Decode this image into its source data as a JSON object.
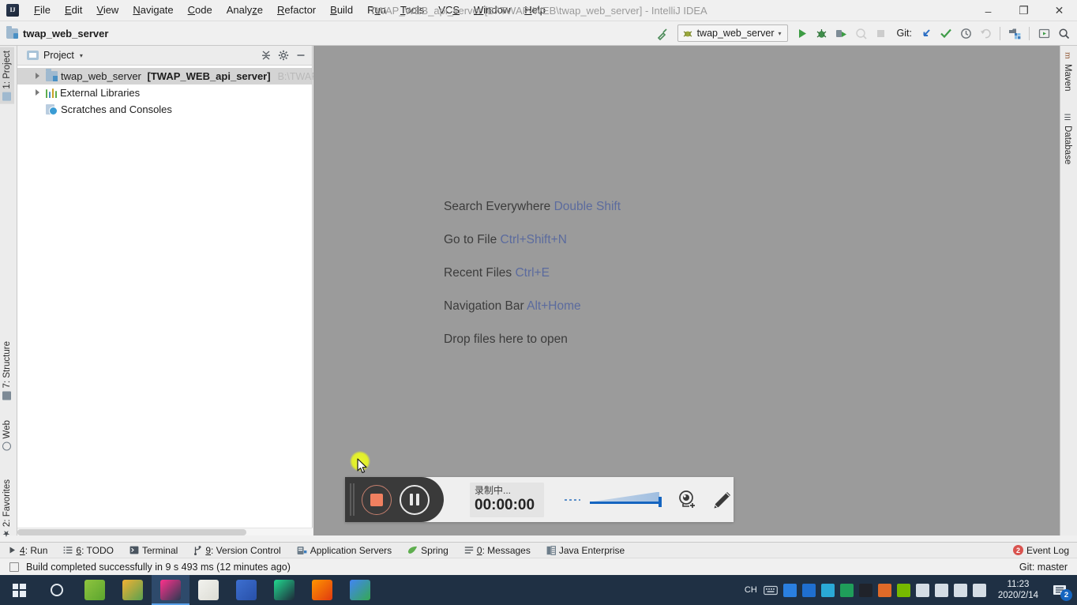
{
  "window": {
    "title": "TWAP_WEB_api_server [B:\\TWAP-WEB\\twap_web_server] - IntelliJ IDEA",
    "minimize": "–",
    "maximize": "❐",
    "close": "✕",
    "logo_text": "IJ"
  },
  "menubar": {
    "items": [
      {
        "label": "File",
        "mnemonic": "F"
      },
      {
        "label": "Edit",
        "mnemonic": "E"
      },
      {
        "label": "View",
        "mnemonic": "V"
      },
      {
        "label": "Navigate",
        "mnemonic": "N"
      },
      {
        "label": "Code",
        "mnemonic": "C"
      },
      {
        "label": "Analyze",
        "mnemonic": "z"
      },
      {
        "label": "Refactor",
        "mnemonic": "R"
      },
      {
        "label": "Build",
        "mnemonic": "B"
      },
      {
        "label": "Run",
        "mnemonic": "u"
      },
      {
        "label": "Tools",
        "mnemonic": "T"
      },
      {
        "label": "VCS",
        "mnemonic": "S"
      },
      {
        "label": "Window",
        "mnemonic": "W"
      },
      {
        "label": "Help",
        "mnemonic": "H"
      }
    ]
  },
  "toolbar": {
    "breadcrumb": "twap_web_server",
    "run_config": "twap_web_server",
    "git_label": "Git:",
    "icons": [
      "build-hammer-icon",
      "run-icon",
      "debug-icon",
      "run-with-coverage-icon",
      "profile-icon",
      "stop-icon",
      "update-project-icon",
      "commit-icon",
      "history-icon",
      "rollback-icon",
      "settings-structure-icon",
      "open-preview-icon",
      "search-everywhere-icon"
    ]
  },
  "stripe_left": {
    "tabs": [
      {
        "label": "1: Project",
        "icon": "project-icon",
        "active": true
      },
      {
        "label": "7: Structure",
        "icon": "structure-icon",
        "active": false
      },
      {
        "label": "Web",
        "icon": "web-icon",
        "active": false
      },
      {
        "label": "2: Favorites",
        "icon": "star-icon",
        "active": false
      }
    ]
  },
  "stripe_right": {
    "tabs": [
      {
        "label": "Maven",
        "icon": "maven-icon"
      },
      {
        "label": "Database",
        "icon": "database-icon"
      }
    ]
  },
  "project_panel": {
    "title": "Project",
    "chevron": "▾",
    "actions": [
      "collapse-all-icon",
      "settings-gear-icon",
      "hide-icon"
    ],
    "tree": [
      {
        "name": "twap_web_server",
        "module": "[TWAP_WEB_api_server]",
        "path": "B:\\TWAP-WEB",
        "icon": "module-icon",
        "expandable": true,
        "selected": true,
        "indent": 0
      },
      {
        "name": "External Libraries",
        "module": "",
        "path": "",
        "icon": "library-icon",
        "expandable": true,
        "selected": false,
        "indent": 0
      },
      {
        "name": "Scratches and Consoles",
        "module": "",
        "path": "",
        "icon": "scratches-icon",
        "expandable": false,
        "selected": false,
        "indent": 0
      }
    ]
  },
  "editor": {
    "hints": [
      {
        "text": "Search Everywhere ",
        "key": "Double Shift"
      },
      {
        "text": "Go to File ",
        "key": "Ctrl+Shift+N"
      },
      {
        "text": "Recent Files ",
        "key": "Ctrl+E"
      },
      {
        "text": "Navigation Bar ",
        "key": "Alt+Home"
      },
      {
        "text": "Drop files here to open",
        "key": ""
      }
    ]
  },
  "recorder": {
    "status": "录制中...",
    "time": "00:00:00",
    "stop_label": "stop-recording-button",
    "pause_label": "pause-recording-button",
    "camera_label": "add-webcam-button",
    "pen_label": "annotation-pen-button",
    "volume_label": "microphone-volume-slider"
  },
  "toolwindow_bar": {
    "items": [
      {
        "label": "4: Run",
        "mnemonic": "4",
        "icon": "run-arrow-icon"
      },
      {
        "label": "6: TODO",
        "mnemonic": "6",
        "icon": "todo-list-icon"
      },
      {
        "label": "Terminal",
        "mnemonic": "",
        "icon": "terminal-icon"
      },
      {
        "label": "9: Version Control",
        "mnemonic": "9",
        "icon": "branch-icon"
      },
      {
        "label": "Application Servers",
        "mnemonic": "",
        "icon": "server-icon"
      },
      {
        "label": "Spring",
        "mnemonic": "",
        "icon": "spring-leaf-icon"
      },
      {
        "label": "0: Messages",
        "mnemonic": "0",
        "icon": "messages-icon"
      },
      {
        "label": "Java Enterprise",
        "mnemonic": "",
        "icon": "java-ee-icon"
      }
    ],
    "event_log": "Event Log",
    "event_log_badge": "2"
  },
  "statusbar": {
    "message": "Build completed successfully in 9 s 493 ms (12 minutes ago)",
    "git_branch": "Git: master"
  },
  "taskbar": {
    "start_label": "start-button",
    "cortana_label": "cortana-search-button",
    "apps": [
      {
        "name": "pycharm-edu-app",
        "color1": "#8fc43f",
        "color2": "#5ba52e"
      },
      {
        "name": "chrome-canary-app",
        "color1": "#f2b134",
        "color2": "#59a14f"
      },
      {
        "name": "intellij-idea-app",
        "color1": "#ff318c",
        "color2": "#2b3a52",
        "active": true
      },
      {
        "name": "typora-app",
        "color1": "#f2f2ee",
        "color2": "#dcdcd4"
      },
      {
        "name": "vysor-app",
        "color1": "#3d6fd0",
        "color2": "#2850a8"
      },
      {
        "name": "webstorm-app",
        "color1": "#22d88f",
        "color2": "#1d2b3a"
      },
      {
        "name": "firefox-app",
        "color1": "#ff9500",
        "color2": "#e03a10"
      },
      {
        "name": "chrome-app",
        "color1": "#4285f4",
        "color2": "#34a853"
      }
    ],
    "ime": "CH",
    "tray": [
      {
        "name": "ime-keyboard-icon",
        "color": "#b8c6d4"
      },
      {
        "name": "baidu-netdisk-icon",
        "color": "#2a7fe0"
      },
      {
        "name": "pdf-reader-icon",
        "color": "#1f6fd0"
      },
      {
        "name": "screen-recorder-icon",
        "color": "#2aa9d6"
      },
      {
        "name": "wps-cloud-icon",
        "color": "#1f9e5a"
      },
      {
        "name": "intellij-tray-icon",
        "color": "#20232a"
      },
      {
        "name": "sync-tool-icon",
        "color": "#e06a28"
      },
      {
        "name": "nvidia-icon",
        "color": "#76b900"
      },
      {
        "name": "network-icon",
        "color": "#d5dde5"
      },
      {
        "name": "volume-icon",
        "color": "#d5dde5"
      },
      {
        "name": "display-icon",
        "color": "#d5dde5"
      },
      {
        "name": "battery-icon",
        "color": "#d5dde5"
      }
    ],
    "time": "11:23",
    "date": "2020/2/14",
    "notification_count": "2"
  }
}
